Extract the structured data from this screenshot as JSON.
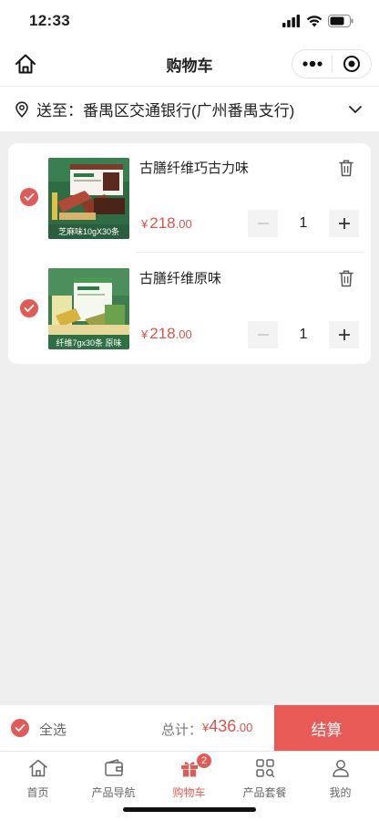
{
  "status": {
    "time": "12:33"
  },
  "nav": {
    "title": "购物车"
  },
  "address": {
    "prefix": "送至：",
    "text": "番禺区交通银行(广州番禺支行)"
  },
  "items": [
    {
      "name": "古膳纤维巧古力味",
      "price_currency": "¥",
      "price_int": "218",
      "price_dec": ".00",
      "quantity": "1",
      "checked": true,
      "image_caption": "芝麻味10gX30条"
    },
    {
      "name": "古膳纤维原味",
      "price_currency": "¥",
      "price_int": "218",
      "price_dec": ".00",
      "quantity": "1",
      "checked": true,
      "image_caption": "纤维7gx30条  原味"
    }
  ],
  "checkout": {
    "select_all_label": "全选",
    "total_label": "总计：",
    "total_currency": "¥",
    "total_int": "436",
    "total_dec": ".00",
    "button_label": "结算"
  },
  "tabs": [
    {
      "label": "首页",
      "icon": "home-icon",
      "active": false
    },
    {
      "label": "产品导航",
      "icon": "wallet-icon",
      "active": false
    },
    {
      "label": "购物车",
      "icon": "gift-icon",
      "active": true,
      "badge": "2"
    },
    {
      "label": "产品套餐",
      "icon": "grid-search-icon",
      "active": false
    },
    {
      "label": "我的",
      "icon": "user-icon",
      "active": false
    }
  ],
  "colors": {
    "accent": "#e05b56",
    "checkout_button": "#e75a55",
    "page_bg": "#efefef"
  }
}
